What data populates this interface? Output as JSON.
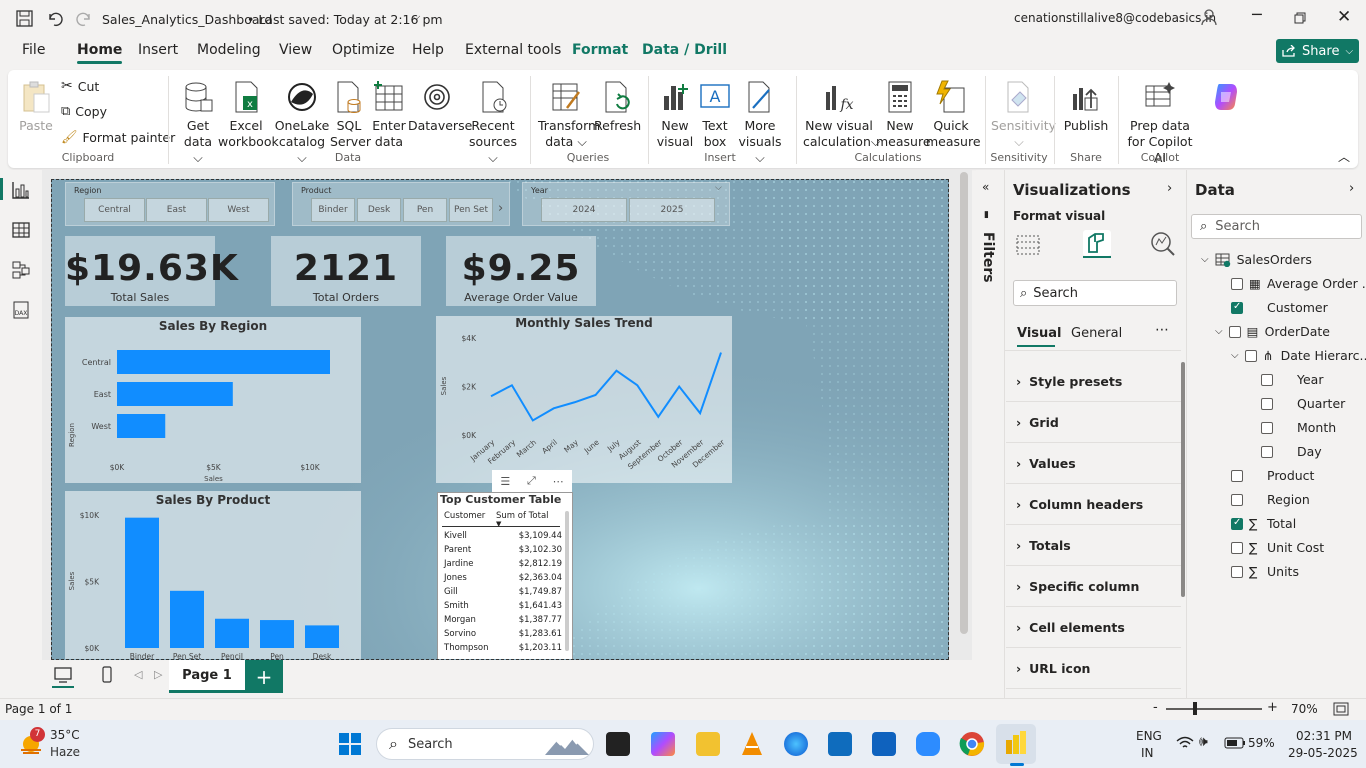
{
  "titlebar": {
    "file_name": "Sales_Analytics_Dashboard",
    "save_status": "• Last saved: Today at 2:16 pm",
    "user_email": "cenationstillalive8@codebasics.in"
  },
  "menu": {
    "items": [
      "File",
      "Home",
      "Insert",
      "Modeling",
      "View",
      "Optimize",
      "Help",
      "External tools",
      "Format",
      "Data / Drill"
    ],
    "active": "Home",
    "share_label": "Share"
  },
  "ribbon": {
    "clipboard": {
      "paste": "Paste",
      "cut": "Cut",
      "copy": "Copy",
      "format_painter": "Format painter",
      "group": "Clipboard"
    },
    "data": {
      "get_data": "Get",
      "get_data2": "data",
      "excel": "Excel",
      "excel2": "workbook",
      "onelake": "OneLake",
      "onelake2": "catalog",
      "sql": "SQL",
      "sql2": "Server",
      "enter": "Enter",
      "enter2": "data",
      "dataverse": "Dataverse",
      "recent": "Recent",
      "recent2": "sources",
      "group": "Data"
    },
    "queries": {
      "transform": "Transform",
      "transform2": "data",
      "refresh": "Refresh",
      "group": "Queries"
    },
    "insert": {
      "new_visual": "New",
      "new_visual2": "visual",
      "text_box": "Text",
      "text_box2": "box",
      "more_visuals": "More",
      "more_visuals2": "visuals",
      "group": "Insert"
    },
    "calculations": {
      "new_calc": "New visual",
      "new_calc2": "calculation",
      "new_measure": "New",
      "new_measure2": "measure",
      "quick_measure": "Quick",
      "quick_measure2": "measure",
      "group": "Calculations"
    },
    "sensitivity": {
      "label": "Sensitivity",
      "group": "Sensitivity"
    },
    "share": {
      "publish": "Publish",
      "group": "Share"
    },
    "copilot": {
      "prep": "Prep data for Copilot",
      "prep2": "AI",
      "group": "Copilot"
    }
  },
  "report": {
    "region_slicer": {
      "label": "Region",
      "options": [
        "Central",
        "East",
        "West"
      ]
    },
    "product_slicer": {
      "label": "Product",
      "options": [
        "Binder",
        "Desk",
        "Pen",
        "Pen Set"
      ]
    },
    "year_slicer": {
      "label": "Year",
      "options": [
        "2024",
        "2025"
      ]
    },
    "cards": [
      {
        "value": "$19.63K",
        "label": "Total Sales"
      },
      {
        "value": "2121",
        "label": "Total Orders"
      },
      {
        "value": "$9.25",
        "label": "Average Order Value"
      }
    ],
    "table": {
      "title": "Top Customer Table",
      "headers": [
        "Customer",
        "Sum of Total"
      ],
      "rows": [
        [
          "Kivell",
          "$3,109.44"
        ],
        [
          "Parent",
          "$3,102.30"
        ],
        [
          "Jardine",
          "$2,812.19"
        ],
        [
          "Jones",
          "$2,363.04"
        ],
        [
          "Gill",
          "$1,749.87"
        ],
        [
          "Smith",
          "$1,641.43"
        ],
        [
          "Morgan",
          "$1,387.77"
        ],
        [
          "Sorvino",
          "$1,283.61"
        ],
        [
          "Thompson",
          "$1,203.11"
        ]
      ]
    }
  },
  "chart_data": [
    {
      "type": "bar",
      "orientation": "horizontal",
      "title": "Sales By Region",
      "categories": [
        "Central",
        "East",
        "West"
      ],
      "values": [
        11100,
        6000,
        2500
      ],
      "xlabel": "Sales",
      "ylabel": "Region",
      "xlim": [
        0,
        10000
      ],
      "ticks": [
        "$0K",
        "$5K",
        "$10K"
      ],
      "color": "#118DFF"
    },
    {
      "type": "line",
      "title": "Monthly Sales Trend",
      "categories": [
        "January",
        "February",
        "March",
        "April",
        "May",
        "June",
        "July",
        "August",
        "September",
        "October",
        "November",
        "December"
      ],
      "values": [
        1600,
        2050,
        600,
        1100,
        1350,
        1650,
        2650,
        2050,
        750,
        2000,
        900,
        3400
      ],
      "ylabel": "Sales",
      "ylim": [
        0,
        4000
      ],
      "ticks": [
        "$0K",
        "$2K",
        "$4K"
      ],
      "color": "#118DFF"
    },
    {
      "type": "bar",
      "title": "Sales By Product",
      "categories": [
        "Binder",
        "Pen Set",
        "Pencil",
        "Pen",
        "Desk"
      ],
      "values": [
        9800,
        4300,
        2200,
        2100,
        1700
      ],
      "ylabel": "Sales",
      "ylim": [
        0,
        10000
      ],
      "ticks": [
        "$0K",
        "$5K",
        "$10K"
      ],
      "color": "#118DFF"
    }
  ],
  "bottom": {
    "page_label": "Page 1"
  },
  "filters": {
    "label": "Filters"
  },
  "viz_pane": {
    "title": "Visualizations",
    "subtitle": "Format visual",
    "search": "Search",
    "tabs": [
      "Visual",
      "General"
    ],
    "sections": [
      "Style presets",
      "Grid",
      "Values",
      "Column headers",
      "Totals",
      "Specific column",
      "Cell elements",
      "URL icon"
    ]
  },
  "data_pane": {
    "title": "Data",
    "search": "Search",
    "table": "SalesOrders",
    "fields": [
      {
        "name": "Average Order ...",
        "checked": false,
        "indent": 1,
        "kind": "calc"
      },
      {
        "name": "Customer",
        "checked": true,
        "indent": 1,
        "kind": "text"
      },
      {
        "name": "OrderDate",
        "checked": false,
        "indent": 1,
        "kind": "date"
      },
      {
        "name": "Date Hierarc...",
        "checked": false,
        "indent": 2,
        "kind": "hier"
      },
      {
        "name": "Year",
        "checked": false,
        "indent": 3,
        "kind": "text"
      },
      {
        "name": "Quarter",
        "checked": false,
        "indent": 3,
        "kind": "text"
      },
      {
        "name": "Month",
        "checked": false,
        "indent": 3,
        "kind": "text"
      },
      {
        "name": "Day",
        "checked": false,
        "indent": 3,
        "kind": "text"
      },
      {
        "name": "Product",
        "checked": false,
        "indent": 1,
        "kind": "text"
      },
      {
        "name": "Region",
        "checked": false,
        "indent": 1,
        "kind": "text"
      },
      {
        "name": "Total",
        "checked": true,
        "indent": 1,
        "kind": "sum"
      },
      {
        "name": "Unit Cost",
        "checked": false,
        "indent": 1,
        "kind": "sum"
      },
      {
        "name": "Units",
        "checked": false,
        "indent": 1,
        "kind": "sum"
      }
    ]
  },
  "status": {
    "page": "Page 1 of 1",
    "zoom": "70%"
  },
  "taskbar": {
    "weather_badge": "7",
    "temp": "35°C",
    "condition": "Haze",
    "search": "Search",
    "lang1": "ENG",
    "lang2": "IN",
    "battery": "59%",
    "time": "02:31 PM",
    "date": "29-05-2025"
  }
}
